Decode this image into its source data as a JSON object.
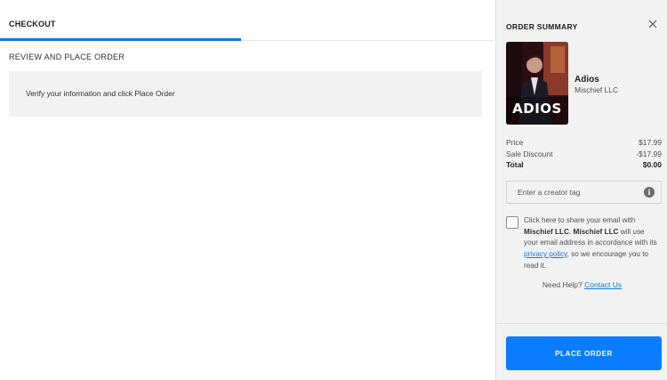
{
  "checkout": {
    "tab_label": "CHECKOUT",
    "section_title": "REVIEW AND PLACE ORDER",
    "info_text": "Verify your information and click Place Order"
  },
  "summary": {
    "title": "ORDER SUMMARY",
    "close_icon": "close-icon",
    "product": {
      "art_text": "ADIOS",
      "name": "Adios",
      "publisher": "Mischief LLC"
    },
    "prices": [
      {
        "label": "Price",
        "value": "$17.99"
      },
      {
        "label": "Sale Discount",
        "value": "-$17.99"
      },
      {
        "label": "Total",
        "value": "$0.00"
      }
    ],
    "creator_tag": {
      "placeholder": "Enter a creator tag",
      "value": "",
      "info_icon": "info-icon"
    },
    "consent": {
      "part1": "Click here to share your email with ",
      "publisher_bold_1": "Mischief LLC",
      "part2": ". ",
      "publisher_bold_2": "Mischief LLC",
      "part3": " will use your email address in accordance with its ",
      "privacy_link": "privacy policy",
      "part4": ", so we encourage you to read it."
    },
    "help": {
      "prefix": "Need Help? ",
      "link": "Contact Us"
    },
    "place_order_label": "PLACE ORDER"
  },
  "colors": {
    "accent": "#0a7cff",
    "tab_underline": "#0d7ae1",
    "summary_bg": "#f2f2f2"
  }
}
